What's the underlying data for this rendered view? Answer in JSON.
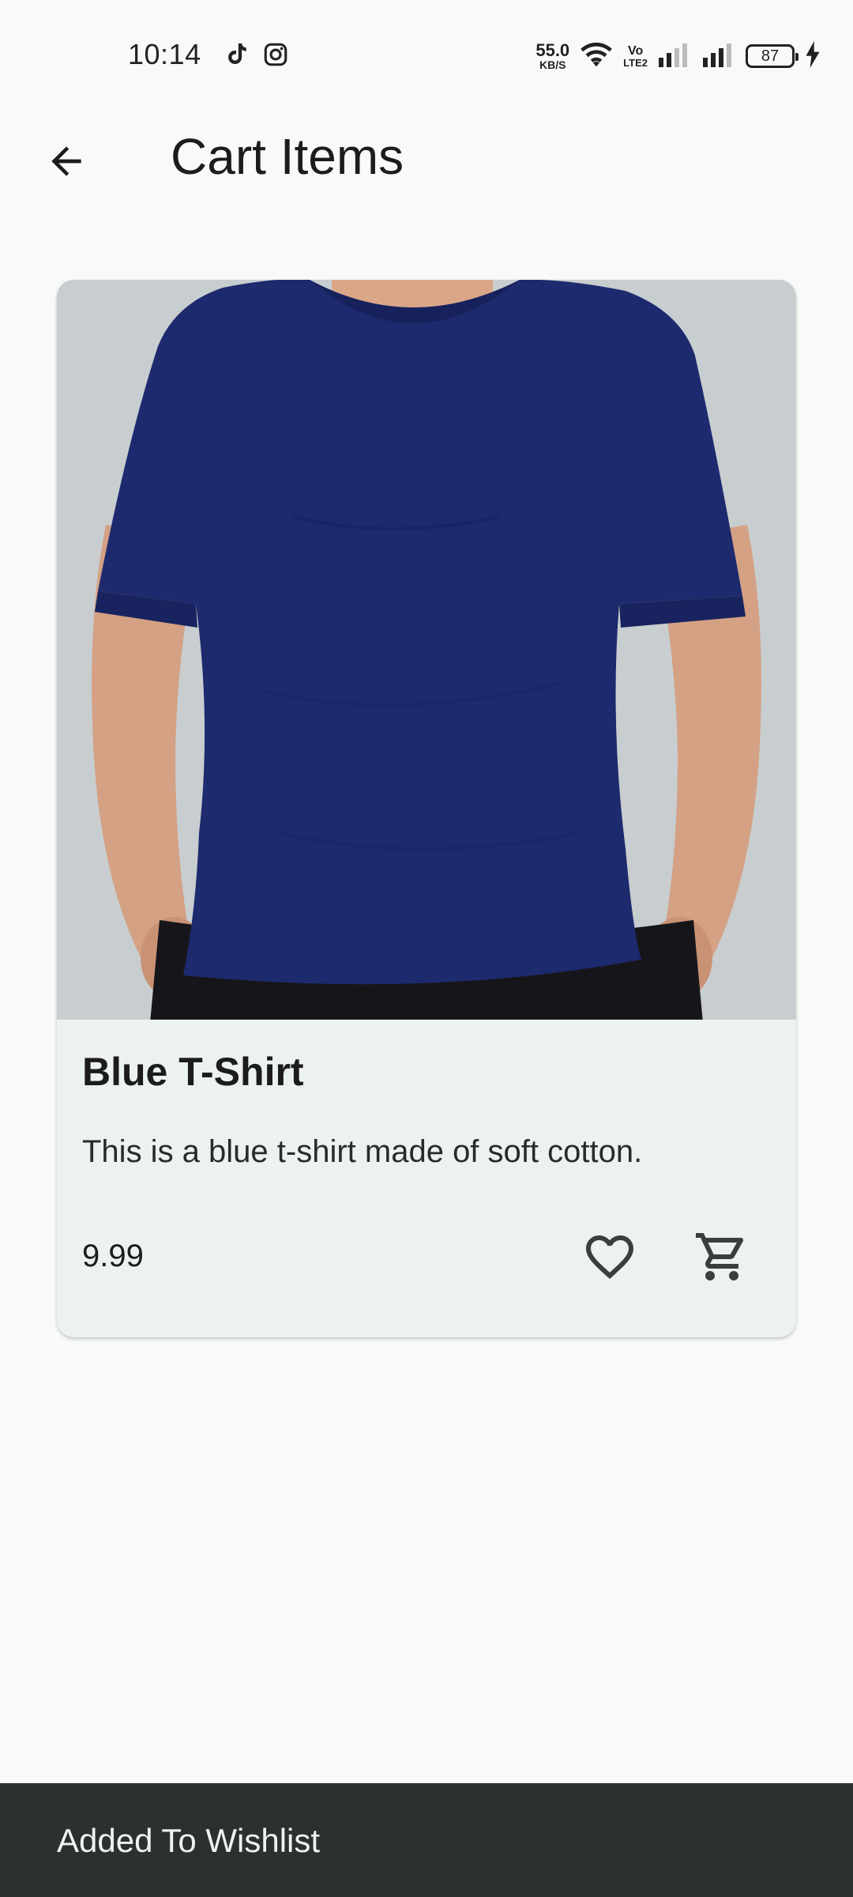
{
  "status_bar": {
    "time": "10:14",
    "net_speed_value": "55.0",
    "net_speed_unit": "KB/S",
    "volte_top": "Vo",
    "volte_bottom": "LTE2",
    "battery_level": "87",
    "icons": [
      "tiktok-icon",
      "instagram-icon",
      "wifi-icon",
      "signal-icon",
      "signal-icon",
      "charging-icon"
    ]
  },
  "app_bar": {
    "title": "Cart Items",
    "back_icon": "arrow-left-icon"
  },
  "product": {
    "image_label": "blue t-shirt photo",
    "name": "Blue T-Shirt",
    "description": "This is a blue t-shirt made of soft cotton.",
    "price": "9.99",
    "wishlist_icon": "heart-outline-icon",
    "cart_icon": "shopping-cart-icon"
  },
  "snackbar": {
    "message": "Added To Wishlist"
  },
  "colors": {
    "background": "#f8faf9",
    "card": "#ecf2f0",
    "shirt": "#1e2a6e",
    "snackbar": "#2d3031"
  }
}
